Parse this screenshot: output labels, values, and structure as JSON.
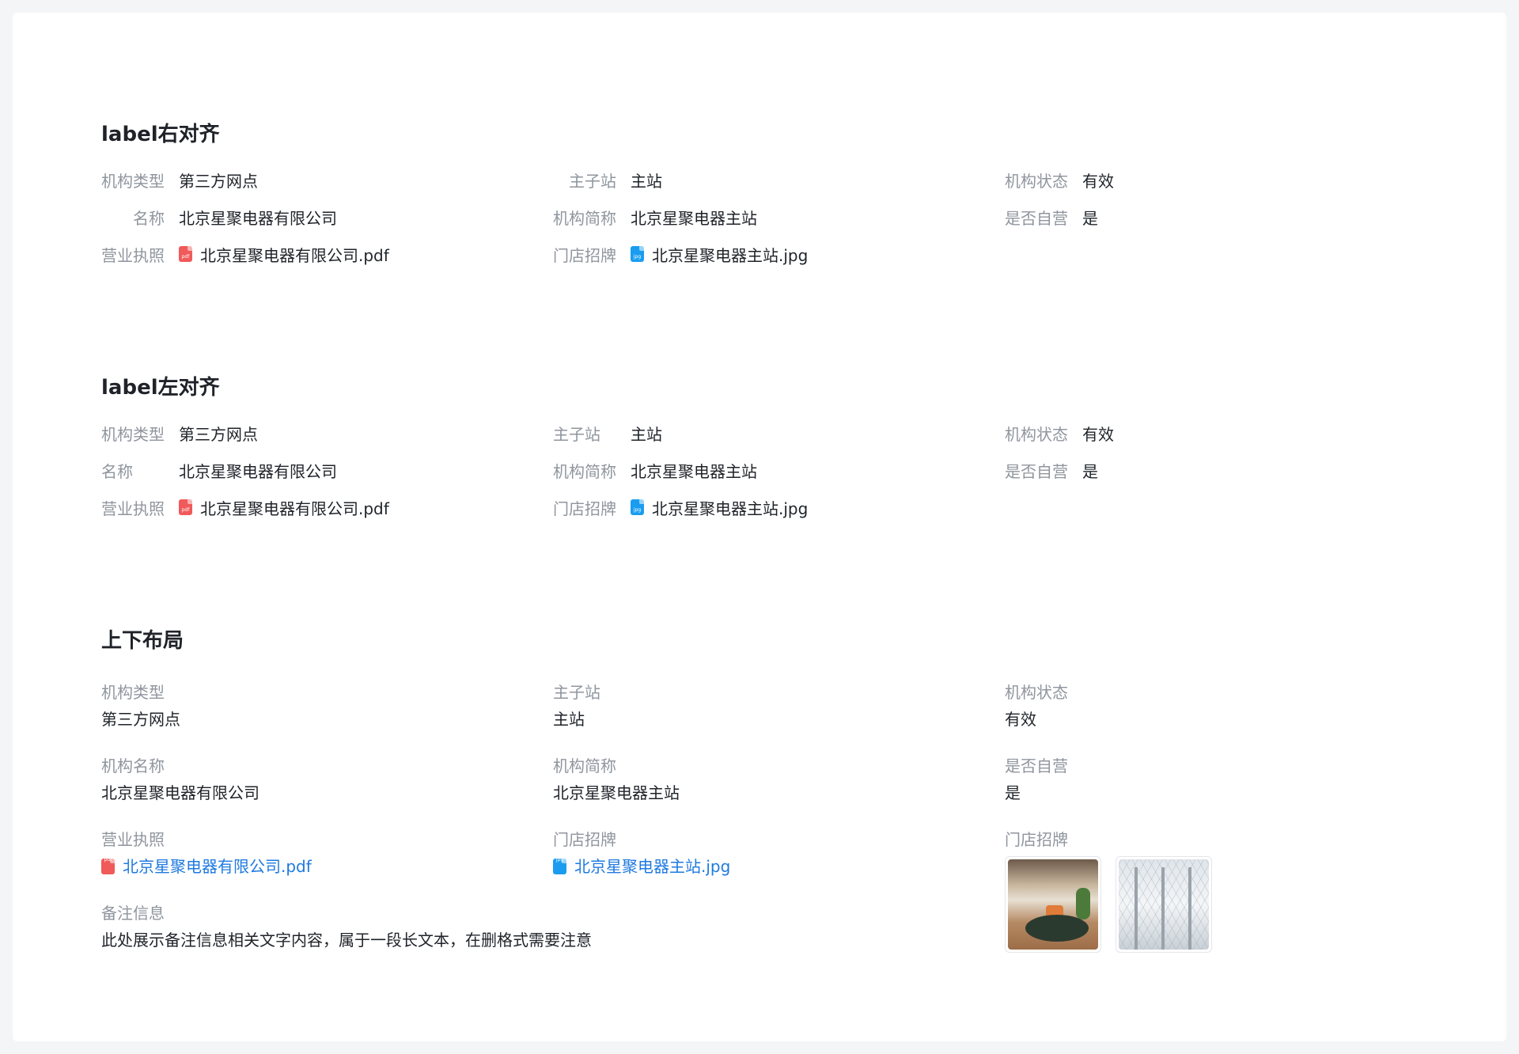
{
  "sections": [
    {
      "title": "label右对齐",
      "rows": [
        [
          {
            "label": "机构类型",
            "value": "第三方网点"
          },
          {
            "label": "主子站",
            "value": "主站"
          },
          {
            "label": "机构状态",
            "value": "有效"
          }
        ],
        [
          {
            "label": "名称",
            "value": "北京星聚电器有限公司"
          },
          {
            "label": "机构简称",
            "value": "北京星聚电器主站"
          },
          {
            "label": "是否自营",
            "value": "是"
          }
        ],
        [
          {
            "label": "营业执照",
            "file": {
              "name": "北京星聚电器有限公司.pdf",
              "type": "pdf",
              "icon": "pdf-file-icon"
            }
          },
          {
            "label": "门店招牌",
            "file": {
              "name": "北京星聚电器主站.jpg",
              "type": "jpg",
              "icon": "jpg-file-icon"
            }
          }
        ]
      ]
    },
    {
      "title": "label左对齐",
      "rows": [
        [
          {
            "label": "机构类型",
            "value": "第三方网点"
          },
          {
            "label": "主子站",
            "value": "主站"
          },
          {
            "label": "机构状态",
            "value": "有效"
          }
        ],
        [
          {
            "label": "名称",
            "value": "北京星聚电器有限公司"
          },
          {
            "label": "机构简称",
            "value": "北京星聚电器主站"
          },
          {
            "label": "是否自营",
            "value": "是"
          }
        ],
        [
          {
            "label": "营业执照",
            "file": {
              "name": "北京星聚电器有限公司.pdf",
              "type": "pdf",
              "icon": "pdf-file-icon"
            }
          },
          {
            "label": "门店招牌",
            "file": {
              "name": "北京星聚电器主站.jpg",
              "type": "jpg",
              "icon": "jpg-file-icon"
            }
          }
        ]
      ]
    },
    {
      "title": "上下布局",
      "items": {
        "org_type": {
          "label": "机构类型",
          "value": "第三方网点"
        },
        "main_sub": {
          "label": "主子站",
          "value": "主站"
        },
        "status": {
          "label": "机构状态",
          "value": "有效"
        },
        "org_name": {
          "label": "机构名称",
          "value": "北京星聚电器有限公司"
        },
        "short_name": {
          "label": "机构简称",
          "value": "北京星聚电器主站"
        },
        "self_run": {
          "label": "是否自营",
          "value": "是"
        },
        "license": {
          "label": "营业执照",
          "file": "北京星聚电器有限公司.pdf"
        },
        "sign_file": {
          "label": "门店招牌",
          "file": "北京星聚电器主站.jpg"
        },
        "sign_images": {
          "label": "门店招牌",
          "images": [
            "office-interior-image",
            "glass-atrium-image"
          ]
        },
        "remark": {
          "label": "备注信息",
          "value": "此处展示备注信息相关文字内容，属于一段长文本，在删格式需要注意"
        }
      }
    }
  ],
  "file_icon_text": {
    "pdf": "pdf",
    "jpg": "jpg"
  },
  "colors": {
    "page_bg": "#f4f5f7",
    "card_bg": "#ffffff",
    "label": "#8f959e",
    "text": "#1f2329",
    "link": "#1f7ae0",
    "pdf_icon": "#f05a5a",
    "jpg_icon": "#1a9df0"
  }
}
